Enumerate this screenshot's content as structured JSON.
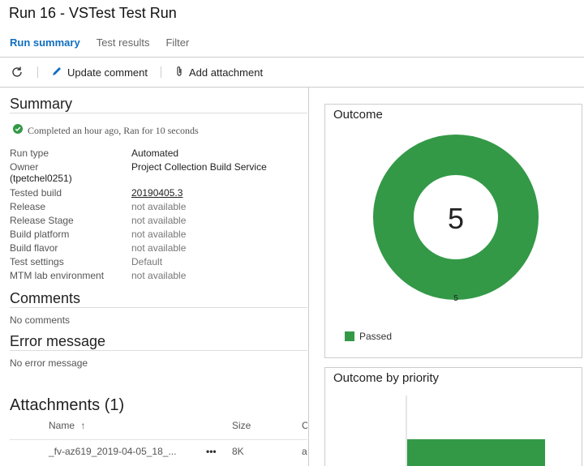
{
  "page": {
    "title": "Run 16 - VSTest Test Run",
    "tabs": [
      {
        "label": "Run summary",
        "active": true
      },
      {
        "label": "Test results",
        "active": false
      },
      {
        "label": "Filter",
        "active": false
      }
    ]
  },
  "toolbar": {
    "refresh_icon": "refresh-icon",
    "update_comment": "Update comment",
    "add_attachment": "Add attachment"
  },
  "summary": {
    "title": "Summary",
    "status": "Completed an hour ago, Ran for 10 seconds",
    "rows": [
      {
        "key": "Run type",
        "value": "Automated"
      },
      {
        "key": "Owner",
        "value": "Project Collection Build Service"
      },
      {
        "key": "(tpetchel0251)",
        "value": ""
      },
      {
        "key": "Tested build",
        "value": "20190405.3"
      },
      {
        "key": "Release",
        "value": "not available"
      },
      {
        "key": "Release Stage",
        "value": "not available"
      },
      {
        "key": "Build platform",
        "value": "not available"
      },
      {
        "key": "Build flavor",
        "value": "not available"
      },
      {
        "key": "Test settings",
        "value": "Default"
      },
      {
        "key": "MTM lab environment",
        "value": "not available"
      }
    ]
  },
  "comments": {
    "title": "Comments",
    "empty": "No comments"
  },
  "error": {
    "title": "Error message",
    "empty": "No error message"
  },
  "attachments": {
    "title": "Attachments (1)",
    "columns": {
      "name": "Name",
      "sort_arrow": "↑",
      "size": "Size",
      "created": "C"
    },
    "rows": [
      {
        "name": "_fv-az619_2019-04-05_18_...",
        "more": "•••",
        "size": "8K",
        "created": "a"
      }
    ]
  },
  "outcome": {
    "title": "Outcome",
    "total": "5",
    "slice_label": "5",
    "legend": "Passed"
  },
  "priority": {
    "title": "Outcome by priority"
  },
  "colors": {
    "passed": "#339947",
    "accent": "#106ebe"
  },
  "chart_data": [
    {
      "type": "pie",
      "title": "Outcome",
      "categories": [
        "Passed"
      ],
      "values": [
        5
      ],
      "legend": "bottom-left"
    },
    {
      "type": "bar",
      "title": "Outcome by priority",
      "series": [
        {
          "name": "Passed",
          "values": [
            5
          ]
        }
      ]
    }
  ]
}
